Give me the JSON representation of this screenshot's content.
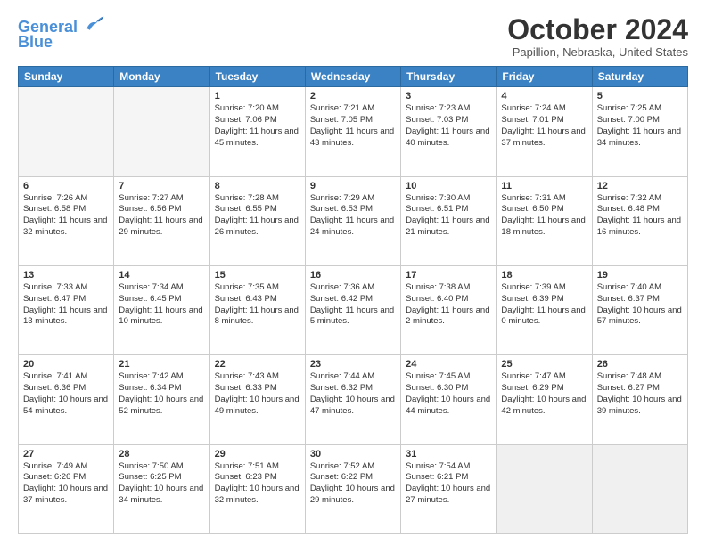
{
  "logo": {
    "line1": "General",
    "line2": "Blue"
  },
  "title": "October 2024",
  "location": "Papillion, Nebraska, United States",
  "days_of_week": [
    "Sunday",
    "Monday",
    "Tuesday",
    "Wednesday",
    "Thursday",
    "Friday",
    "Saturday"
  ],
  "weeks": [
    [
      {
        "day": "",
        "content": "",
        "empty": true
      },
      {
        "day": "",
        "content": "",
        "empty": true
      },
      {
        "day": "1",
        "sunrise": "Sunrise: 7:20 AM",
        "sunset": "Sunset: 7:06 PM",
        "daylight": "Daylight: 11 hours and 45 minutes."
      },
      {
        "day": "2",
        "sunrise": "Sunrise: 7:21 AM",
        "sunset": "Sunset: 7:05 PM",
        "daylight": "Daylight: 11 hours and 43 minutes."
      },
      {
        "day": "3",
        "sunrise": "Sunrise: 7:23 AM",
        "sunset": "Sunset: 7:03 PM",
        "daylight": "Daylight: 11 hours and 40 minutes."
      },
      {
        "day": "4",
        "sunrise": "Sunrise: 7:24 AM",
        "sunset": "Sunset: 7:01 PM",
        "daylight": "Daylight: 11 hours and 37 minutes."
      },
      {
        "day": "5",
        "sunrise": "Sunrise: 7:25 AM",
        "sunset": "Sunset: 7:00 PM",
        "daylight": "Daylight: 11 hours and 34 minutes."
      }
    ],
    [
      {
        "day": "6",
        "sunrise": "Sunrise: 7:26 AM",
        "sunset": "Sunset: 6:58 PM",
        "daylight": "Daylight: 11 hours and 32 minutes."
      },
      {
        "day": "7",
        "sunrise": "Sunrise: 7:27 AM",
        "sunset": "Sunset: 6:56 PM",
        "daylight": "Daylight: 11 hours and 29 minutes."
      },
      {
        "day": "8",
        "sunrise": "Sunrise: 7:28 AM",
        "sunset": "Sunset: 6:55 PM",
        "daylight": "Daylight: 11 hours and 26 minutes."
      },
      {
        "day": "9",
        "sunrise": "Sunrise: 7:29 AM",
        "sunset": "Sunset: 6:53 PM",
        "daylight": "Daylight: 11 hours and 24 minutes."
      },
      {
        "day": "10",
        "sunrise": "Sunrise: 7:30 AM",
        "sunset": "Sunset: 6:51 PM",
        "daylight": "Daylight: 11 hours and 21 minutes."
      },
      {
        "day": "11",
        "sunrise": "Sunrise: 7:31 AM",
        "sunset": "Sunset: 6:50 PM",
        "daylight": "Daylight: 11 hours and 18 minutes."
      },
      {
        "day": "12",
        "sunrise": "Sunrise: 7:32 AM",
        "sunset": "Sunset: 6:48 PM",
        "daylight": "Daylight: 11 hours and 16 minutes."
      }
    ],
    [
      {
        "day": "13",
        "sunrise": "Sunrise: 7:33 AM",
        "sunset": "Sunset: 6:47 PM",
        "daylight": "Daylight: 11 hours and 13 minutes."
      },
      {
        "day": "14",
        "sunrise": "Sunrise: 7:34 AM",
        "sunset": "Sunset: 6:45 PM",
        "daylight": "Daylight: 11 hours and 10 minutes."
      },
      {
        "day": "15",
        "sunrise": "Sunrise: 7:35 AM",
        "sunset": "Sunset: 6:43 PM",
        "daylight": "Daylight: 11 hours and 8 minutes."
      },
      {
        "day": "16",
        "sunrise": "Sunrise: 7:36 AM",
        "sunset": "Sunset: 6:42 PM",
        "daylight": "Daylight: 11 hours and 5 minutes."
      },
      {
        "day": "17",
        "sunrise": "Sunrise: 7:38 AM",
        "sunset": "Sunset: 6:40 PM",
        "daylight": "Daylight: 11 hours and 2 minutes."
      },
      {
        "day": "18",
        "sunrise": "Sunrise: 7:39 AM",
        "sunset": "Sunset: 6:39 PM",
        "daylight": "Daylight: 11 hours and 0 minutes."
      },
      {
        "day": "19",
        "sunrise": "Sunrise: 7:40 AM",
        "sunset": "Sunset: 6:37 PM",
        "daylight": "Daylight: 10 hours and 57 minutes."
      }
    ],
    [
      {
        "day": "20",
        "sunrise": "Sunrise: 7:41 AM",
        "sunset": "Sunset: 6:36 PM",
        "daylight": "Daylight: 10 hours and 54 minutes."
      },
      {
        "day": "21",
        "sunrise": "Sunrise: 7:42 AM",
        "sunset": "Sunset: 6:34 PM",
        "daylight": "Daylight: 10 hours and 52 minutes."
      },
      {
        "day": "22",
        "sunrise": "Sunrise: 7:43 AM",
        "sunset": "Sunset: 6:33 PM",
        "daylight": "Daylight: 10 hours and 49 minutes."
      },
      {
        "day": "23",
        "sunrise": "Sunrise: 7:44 AM",
        "sunset": "Sunset: 6:32 PM",
        "daylight": "Daylight: 10 hours and 47 minutes."
      },
      {
        "day": "24",
        "sunrise": "Sunrise: 7:45 AM",
        "sunset": "Sunset: 6:30 PM",
        "daylight": "Daylight: 10 hours and 44 minutes."
      },
      {
        "day": "25",
        "sunrise": "Sunrise: 7:47 AM",
        "sunset": "Sunset: 6:29 PM",
        "daylight": "Daylight: 10 hours and 42 minutes."
      },
      {
        "day": "26",
        "sunrise": "Sunrise: 7:48 AM",
        "sunset": "Sunset: 6:27 PM",
        "daylight": "Daylight: 10 hours and 39 minutes."
      }
    ],
    [
      {
        "day": "27",
        "sunrise": "Sunrise: 7:49 AM",
        "sunset": "Sunset: 6:26 PM",
        "daylight": "Daylight: 10 hours and 37 minutes."
      },
      {
        "day": "28",
        "sunrise": "Sunrise: 7:50 AM",
        "sunset": "Sunset: 6:25 PM",
        "daylight": "Daylight: 10 hours and 34 minutes."
      },
      {
        "day": "29",
        "sunrise": "Sunrise: 7:51 AM",
        "sunset": "Sunset: 6:23 PM",
        "daylight": "Daylight: 10 hours and 32 minutes."
      },
      {
        "day": "30",
        "sunrise": "Sunrise: 7:52 AM",
        "sunset": "Sunset: 6:22 PM",
        "daylight": "Daylight: 10 hours and 29 minutes."
      },
      {
        "day": "31",
        "sunrise": "Sunrise: 7:54 AM",
        "sunset": "Sunset: 6:21 PM",
        "daylight": "Daylight: 10 hours and 27 minutes."
      },
      {
        "day": "",
        "content": "",
        "empty": true
      },
      {
        "day": "",
        "content": "",
        "empty": true
      }
    ]
  ]
}
